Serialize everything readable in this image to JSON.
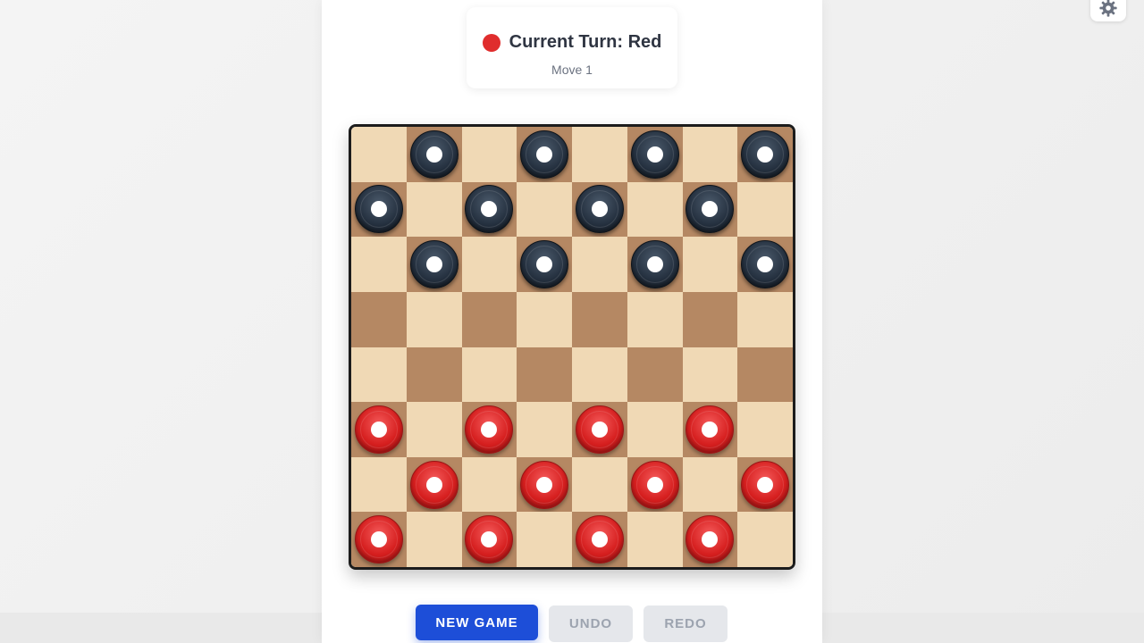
{
  "turn": {
    "label": "Current Turn: Red",
    "move": "Move 1",
    "player_color": "#e02d2d"
  },
  "board": {
    "light_color": "#f0d9b5",
    "dark_color": "#b58863",
    "rows": [
      "-b-b-b-b",
      "b-b-b-b-",
      "-b-b-b-b",
      "--------",
      "--------",
      "r-r-r-r-",
      "-r-r-r-r",
      "r-r-r-r-"
    ]
  },
  "buttons": {
    "new_game": "NEW GAME",
    "undo": "UNDO",
    "redo": "REDO"
  },
  "icons": {
    "settings": "gear-icon"
  }
}
